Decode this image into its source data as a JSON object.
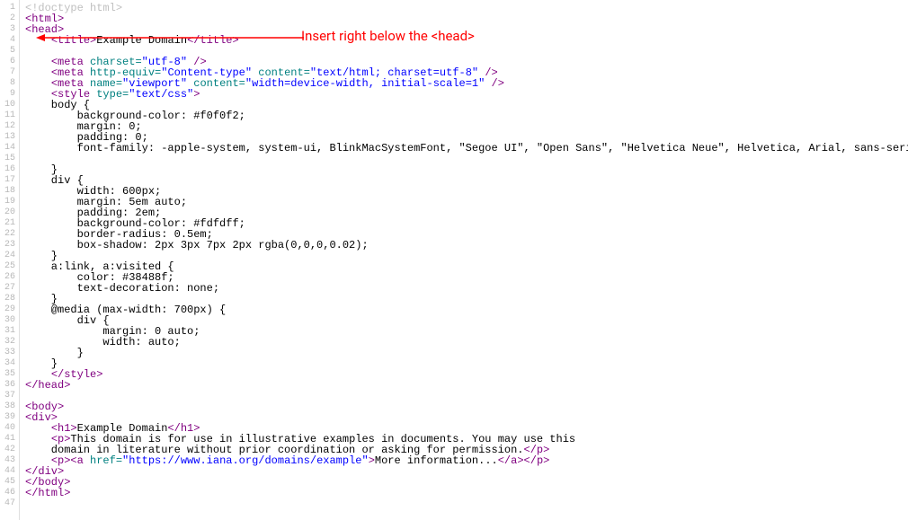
{
  "annotation": {
    "text": "Insert right below the <head>"
  },
  "lines": [
    {
      "n": 1,
      "segs": [
        {
          "c": "dim",
          "t": "<!doctype html>"
        }
      ]
    },
    {
      "n": 2,
      "segs": [
        {
          "c": "tag",
          "t": "<html>"
        }
      ]
    },
    {
      "n": 3,
      "segs": [
        {
          "c": "tag",
          "t": "<head>"
        }
      ]
    },
    {
      "n": 4,
      "segs": [
        {
          "c": "txt",
          "t": "    "
        },
        {
          "c": "tag",
          "t": "<title>"
        },
        {
          "c": "txt",
          "t": "Example Domain"
        },
        {
          "c": "tag",
          "t": "</title>"
        }
      ]
    },
    {
      "n": 5,
      "segs": [
        {
          "c": "txt",
          "t": ""
        }
      ]
    },
    {
      "n": 6,
      "segs": [
        {
          "c": "txt",
          "t": "    "
        },
        {
          "c": "tag",
          "t": "<meta "
        },
        {
          "c": "attrname",
          "t": "charset="
        },
        {
          "c": "attrval",
          "t": "\"utf-8\""
        },
        {
          "c": "tag",
          "t": " />"
        }
      ]
    },
    {
      "n": 7,
      "segs": [
        {
          "c": "txt",
          "t": "    "
        },
        {
          "c": "tag",
          "t": "<meta "
        },
        {
          "c": "attrname",
          "t": "http-equiv="
        },
        {
          "c": "attrval",
          "t": "\"Content-type\""
        },
        {
          "c": "tag",
          "t": " "
        },
        {
          "c": "attrname",
          "t": "content="
        },
        {
          "c": "attrval",
          "t": "\"text/html; charset=utf-8\""
        },
        {
          "c": "tag",
          "t": " />"
        }
      ]
    },
    {
      "n": 8,
      "segs": [
        {
          "c": "txt",
          "t": "    "
        },
        {
          "c": "tag",
          "t": "<meta "
        },
        {
          "c": "attrname",
          "t": "name="
        },
        {
          "c": "attrval",
          "t": "\"viewport\""
        },
        {
          "c": "tag",
          "t": " "
        },
        {
          "c": "attrname",
          "t": "content="
        },
        {
          "c": "attrval",
          "t": "\"width=device-width, initial-scale=1\""
        },
        {
          "c": "tag",
          "t": " />"
        }
      ]
    },
    {
      "n": 9,
      "segs": [
        {
          "c": "txt",
          "t": "    "
        },
        {
          "c": "tag",
          "t": "<style "
        },
        {
          "c": "attrname",
          "t": "type="
        },
        {
          "c": "attrval",
          "t": "\"text/css\""
        },
        {
          "c": "tag",
          "t": ">"
        }
      ]
    },
    {
      "n": 10,
      "segs": [
        {
          "c": "txt",
          "t": "    body {"
        }
      ]
    },
    {
      "n": 11,
      "segs": [
        {
          "c": "txt",
          "t": "        background-color: #f0f0f2;"
        }
      ]
    },
    {
      "n": 12,
      "segs": [
        {
          "c": "txt",
          "t": "        margin: 0;"
        }
      ]
    },
    {
      "n": 13,
      "segs": [
        {
          "c": "txt",
          "t": "        padding: 0;"
        }
      ]
    },
    {
      "n": 14,
      "segs": [
        {
          "c": "txt",
          "t": "        font-family: -apple-system, system-ui, BlinkMacSystemFont, \"Segoe UI\", \"Open Sans\", \"Helvetica Neue\", Helvetica, Arial, sans-serif;"
        }
      ]
    },
    {
      "n": 15,
      "segs": [
        {
          "c": "txt",
          "t": "        "
        }
      ]
    },
    {
      "n": 16,
      "segs": [
        {
          "c": "txt",
          "t": "    }"
        }
      ]
    },
    {
      "n": 17,
      "segs": [
        {
          "c": "txt",
          "t": "    div {"
        }
      ]
    },
    {
      "n": 18,
      "segs": [
        {
          "c": "txt",
          "t": "        width: 600px;"
        }
      ]
    },
    {
      "n": 19,
      "segs": [
        {
          "c": "txt",
          "t": "        margin: 5em auto;"
        }
      ]
    },
    {
      "n": 20,
      "segs": [
        {
          "c": "txt",
          "t": "        padding: 2em;"
        }
      ]
    },
    {
      "n": 21,
      "segs": [
        {
          "c": "txt",
          "t": "        background-color: #fdfdff;"
        }
      ]
    },
    {
      "n": 22,
      "segs": [
        {
          "c": "txt",
          "t": "        border-radius: 0.5em;"
        }
      ]
    },
    {
      "n": 23,
      "segs": [
        {
          "c": "txt",
          "t": "        box-shadow: 2px 3px 7px 2px rgba(0,0,0,0.02);"
        }
      ]
    },
    {
      "n": 24,
      "segs": [
        {
          "c": "txt",
          "t": "    }"
        }
      ]
    },
    {
      "n": 25,
      "segs": [
        {
          "c": "txt",
          "t": "    a:link, a:visited {"
        }
      ]
    },
    {
      "n": 26,
      "segs": [
        {
          "c": "txt",
          "t": "        color: #38488f;"
        }
      ]
    },
    {
      "n": 27,
      "segs": [
        {
          "c": "txt",
          "t": "        text-decoration: none;"
        }
      ]
    },
    {
      "n": 28,
      "segs": [
        {
          "c": "txt",
          "t": "    }"
        }
      ]
    },
    {
      "n": 29,
      "segs": [
        {
          "c": "txt",
          "t": "    @media (max-width: 700px) {"
        }
      ]
    },
    {
      "n": 30,
      "segs": [
        {
          "c": "txt",
          "t": "        div {"
        }
      ]
    },
    {
      "n": 31,
      "segs": [
        {
          "c": "txt",
          "t": "            margin: 0 auto;"
        }
      ]
    },
    {
      "n": 32,
      "segs": [
        {
          "c": "txt",
          "t": "            width: auto;"
        }
      ]
    },
    {
      "n": 33,
      "segs": [
        {
          "c": "txt",
          "t": "        }"
        }
      ]
    },
    {
      "n": 34,
      "segs": [
        {
          "c": "txt",
          "t": "    }"
        }
      ]
    },
    {
      "n": 35,
      "segs": [
        {
          "c": "txt",
          "t": "    "
        },
        {
          "c": "tag",
          "t": "</style>"
        }
      ]
    },
    {
      "n": 36,
      "segs": [
        {
          "c": "tag",
          "t": "</head>"
        }
      ]
    },
    {
      "n": 37,
      "segs": [
        {
          "c": "txt",
          "t": ""
        }
      ]
    },
    {
      "n": 38,
      "segs": [
        {
          "c": "tag",
          "t": "<body>"
        }
      ]
    },
    {
      "n": 39,
      "segs": [
        {
          "c": "tag",
          "t": "<div>"
        }
      ]
    },
    {
      "n": 40,
      "segs": [
        {
          "c": "txt",
          "t": "    "
        },
        {
          "c": "tag",
          "t": "<h1>"
        },
        {
          "c": "txt",
          "t": "Example Domain"
        },
        {
          "c": "tag",
          "t": "</h1>"
        }
      ]
    },
    {
      "n": 41,
      "segs": [
        {
          "c": "txt",
          "t": "    "
        },
        {
          "c": "tag",
          "t": "<p>"
        },
        {
          "c": "txt",
          "t": "This domain is for use in illustrative examples in documents. You may use this"
        }
      ]
    },
    {
      "n": 42,
      "segs": [
        {
          "c": "txt",
          "t": "    domain in literature without prior coordination or asking for permission."
        },
        {
          "c": "tag",
          "t": "</p>"
        }
      ]
    },
    {
      "n": 43,
      "segs": [
        {
          "c": "txt",
          "t": "    "
        },
        {
          "c": "tag",
          "t": "<p><a "
        },
        {
          "c": "attrname",
          "t": "href="
        },
        {
          "c": "attrval",
          "t": "\"https://www.iana.org/domains/example\""
        },
        {
          "c": "tag",
          "t": ">"
        },
        {
          "c": "txt",
          "t": "More information..."
        },
        {
          "c": "tag",
          "t": "</a></p>"
        }
      ]
    },
    {
      "n": 44,
      "segs": [
        {
          "c": "tag",
          "t": "</div>"
        }
      ]
    },
    {
      "n": 45,
      "segs": [
        {
          "c": "tag",
          "t": "</body>"
        }
      ]
    },
    {
      "n": 46,
      "segs": [
        {
          "c": "tag",
          "t": "</html>"
        }
      ]
    },
    {
      "n": 47,
      "segs": [
        {
          "c": "txt",
          "t": ""
        }
      ]
    }
  ]
}
